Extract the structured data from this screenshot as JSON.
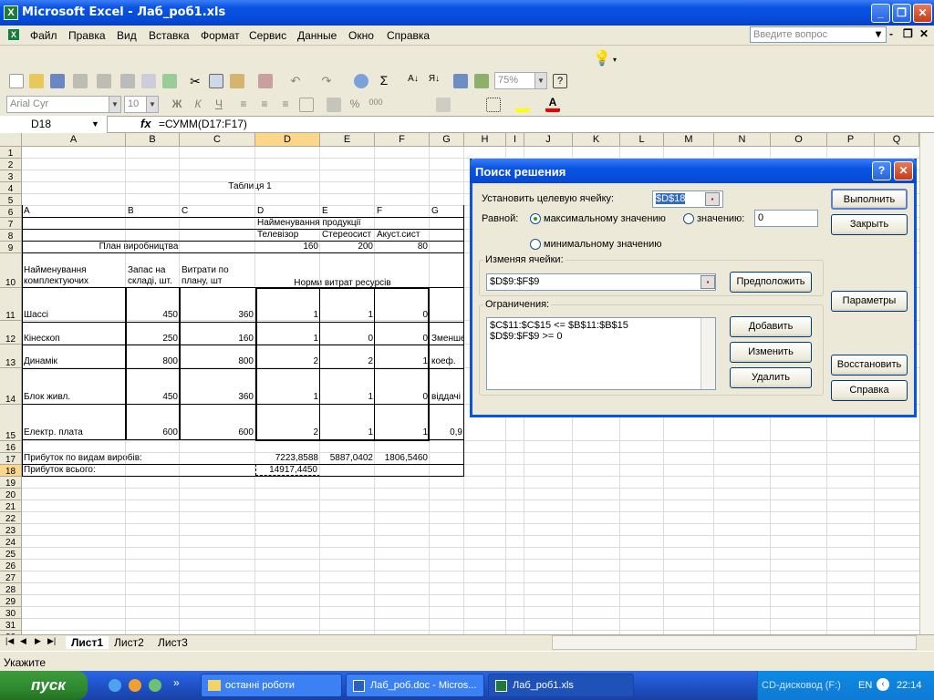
{
  "app": {
    "title": "Microsoft Excel - Лаб_роб1.xls"
  },
  "menu": [
    "Файл",
    "Правка",
    "Вид",
    "Вставка",
    "Формат",
    "Сервис",
    "Данные",
    "Окно",
    "Справка"
  ],
  "ask_placeholder": "Введите вопрос",
  "toolbar": {
    "zoom": "75%",
    "font": "Arial Cyr",
    "size": "10"
  },
  "formula_bar": {
    "name_box": "D18",
    "fx": "fx",
    "formula": "=СУММ(D17:F17)"
  },
  "columns": [
    "A",
    "B",
    "C",
    "D",
    "E",
    "F",
    "G",
    "H",
    "I",
    "J",
    "K",
    "L",
    "M",
    "N",
    "O",
    "P",
    "Q"
  ],
  "rows": [
    "1",
    "2",
    "3",
    "4",
    "5",
    "6",
    "7",
    "8",
    "9",
    "10",
    "11",
    "12",
    "13",
    "14",
    "15",
    "16",
    "17",
    "18",
    "19",
    "20",
    "21",
    "22",
    "23",
    "24",
    "25",
    "26",
    "27",
    "28",
    "29",
    "30",
    "31",
    "32"
  ],
  "sheet": {
    "table_title": "Таблиця 1",
    "r6": {
      "a": "A",
      "b": "B",
      "c": "C",
      "d": "D",
      "e": "E",
      "f": "F",
      "g": "G"
    },
    "product_header": "Найменування продукції",
    "tv": "Телевізор",
    "stereo": "Стереосист",
    "acoustic": "Акуст.сист",
    "plan_label": "План виробництва",
    "plan": [
      "160",
      "200",
      "80"
    ],
    "name_header": "Найменування комплектуючих",
    "stock_header": "Запас на складі, шт.",
    "cost_header": "Витрати по плану, шт",
    "norms_header": "Норми витрат ресурсів",
    "items": [
      {
        "name": "Шассі",
        "stock": "450",
        "cost": "360",
        "d": "1",
        "e": "1",
        "f": "0",
        "g": ""
      },
      {
        "name": "Кінескоп",
        "stock": "250",
        "cost": "160",
        "d": "1",
        "e": "0",
        "f": "0",
        "g": "Зменшен"
      },
      {
        "name": "Динамік",
        "stock": "800",
        "cost": "800",
        "d": "2",
        "e": "2",
        "f": "1",
        "g": "коеф."
      },
      {
        "name": "Блок живл.",
        "stock": "450",
        "cost": "360",
        "d": "1",
        "e": "1",
        "f": "0",
        "g": "віддачі"
      },
      {
        "name": "Електр. плата",
        "stock": "600",
        "cost": "600",
        "d": "2",
        "e": "1",
        "f": "1",
        "g": "0,9"
      }
    ],
    "profit_label": "Прибуток по видам виробів:",
    "profit": [
      "7223,8588",
      "5887,0402",
      "1806,5460"
    ],
    "total_label": "Прибуток всього:",
    "total": "14917,4450"
  },
  "dialog": {
    "title": "Поиск решения",
    "target_label": "Установить целевую ячейку:",
    "target_value": "$D$18",
    "equal_label": "Равной:",
    "max_label": "максимальному значению",
    "value_label": "значению:",
    "value_input": "0",
    "min_label": "минимальному значению",
    "changing_label": "Изменяя ячейки:",
    "changing_value": "$D$9:$F$9",
    "guess_btn": "Предположить",
    "constraints_label": "Ограничения:",
    "constraints": [
      "$C$11:$C$15 <= $B$11:$B$15",
      "$D$9:$F$9 >= 0"
    ],
    "run_btn": "Выполнить",
    "close_btn": "Закрыть",
    "params_btn": "Параметры",
    "add_btn": "Добавить",
    "change_btn": "Изменить",
    "delete_btn": "Удалить",
    "restore_btn": "Восстановить",
    "help_btn": "Справка"
  },
  "sheet_tabs": [
    "Лист1",
    "Лист2",
    "Лист3"
  ],
  "status": "Укажите",
  "taskbar": {
    "start": "пуск",
    "tasks": [
      "останні роботи",
      "Лаб_роб.doc - Micros...",
      "Лаб_роб1.xls"
    ],
    "tray_drive": "CD-дисковод (F:)",
    "lang": "EN",
    "clock": "22:14"
  },
  "colors": {
    "title_blue": "#0a54e3",
    "start_green": "#2f8a2f",
    "selected_col": "#fbd68b"
  }
}
